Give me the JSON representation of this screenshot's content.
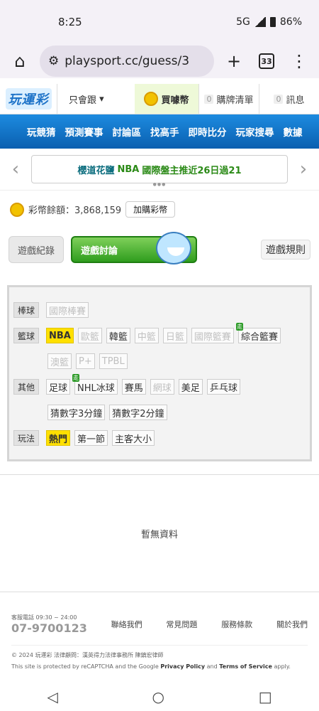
{
  "status": {
    "time": "8:25",
    "network": "5G",
    "battery": "86%"
  },
  "browser": {
    "url": "playsport.cc/guess/3",
    "tabs": "33"
  },
  "site_top": {
    "logo": "玩運彩",
    "follow": "只會跟",
    "buy": "買噱幣",
    "buy_list": "購牌清單",
    "buy_list_count": "0",
    "msg": "訊息",
    "msg_count": "0"
  },
  "nav": [
    "玩競猜",
    "預測賽事",
    "討論區",
    "找高手",
    "即時比分",
    "玩家搜尋",
    "數據"
  ],
  "banner": {
    "prefix": "櫻道花鹽",
    "highlight": "NBA",
    "suffix": "國際盤主推近26日過21"
  },
  "coins": {
    "label": "彩幣餘額：3,868,159",
    "add": "加購彩幣"
  },
  "game_tabs": {
    "record": "遊戲紀錄",
    "discuss": "遊戲討論",
    "rules": "遊戲規則"
  },
  "filters": {
    "baseball": {
      "label": "棒球",
      "chips": [
        "國際棒賽"
      ]
    },
    "basketball": {
      "label": "籃球",
      "chips": [
        "NBA",
        "歐籃",
        "韓籃",
        "中籃",
        "日籃",
        "國際籃賽",
        "綜合籃賽"
      ],
      "chips2": [
        "澳籃",
        "P+",
        "TPBL"
      ]
    },
    "other": {
      "label": "其他",
      "chips": [
        "足球",
        "NHL冰球",
        "賽馬",
        "網球",
        "美足",
        "乒乓球"
      ],
      "chips2": [
        "猜數字3分鐘",
        "猜數字2分鐘"
      ]
    },
    "mode": {
      "label": "玩法",
      "chips": [
        "熱門",
        "第一節",
        "主客大小"
      ]
    },
    "new_tag": "走"
  },
  "empty_text": "暫無資料",
  "footer": {
    "phone_label": "客服電話 09:30 ~ 24:00",
    "phone": "07-9700123",
    "links": [
      "聯絡我們",
      "常見問題",
      "服務條款",
      "關於我們"
    ],
    "copyright": "© 2024 玩運彩 法律顧問：漢英得力法律事務所 陳鎮宏律師",
    "recaptcha_pre": "This site is protected by reCAPTCHA and the Google",
    "privacy": "Privacy Policy",
    "and": "and",
    "terms": "Terms of Service",
    "apply": "apply."
  }
}
